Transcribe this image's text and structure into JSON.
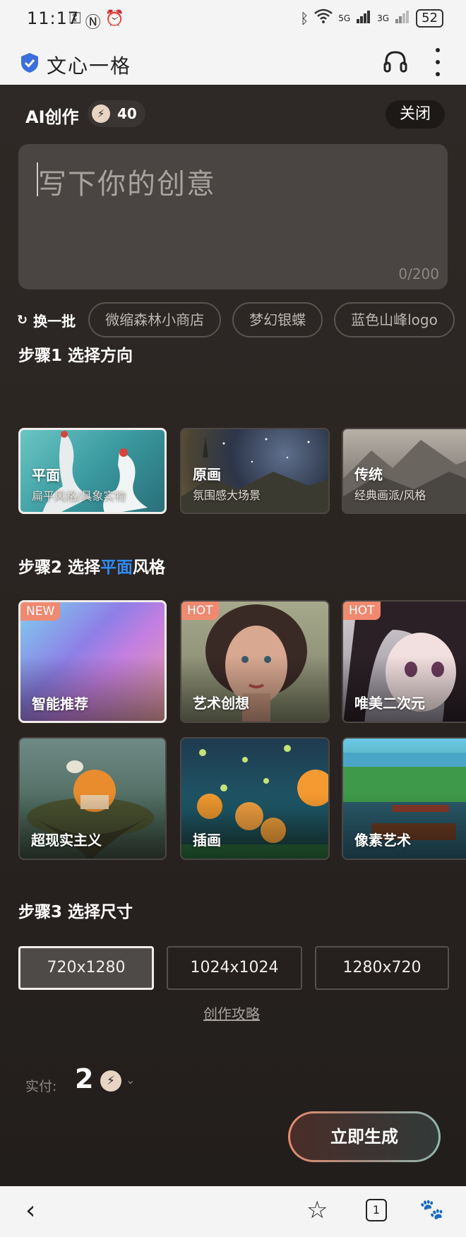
{
  "status_bar": {
    "time": "11:17",
    "left_icons": [
      "key-icon",
      "nfc-icon",
      "alarm-icon"
    ],
    "network_5g": "5G",
    "network_3g": "3G",
    "battery": "52"
  },
  "app_bar": {
    "title": "文心一格",
    "shield_color": "#3b6fe0"
  },
  "header": {
    "title": "AI创作",
    "credits": "40",
    "close_label": "关闭"
  },
  "prompt": {
    "placeholder": "写下你的创意",
    "counter": "0/200"
  },
  "suggestions": {
    "refresh_label": "换一批",
    "chips": [
      "微缩森林小商店",
      "梦幻银蝶",
      "蓝色山峰logo"
    ]
  },
  "step1": {
    "title": "步骤1 选择方向",
    "options": [
      {
        "label": "平面",
        "sub": "扁平风格/具象实物",
        "selected": true
      },
      {
        "label": "原画",
        "sub": "氛围感大场景",
        "selected": false
      },
      {
        "label": "传统",
        "sub": "经典画派/风格",
        "selected": false
      }
    ]
  },
  "step2": {
    "title_pre": "步骤2 选择",
    "title_accent": "平面",
    "title_post": "风格",
    "accent_color": "#2f8cf4",
    "styles": [
      {
        "label": "智能推荐",
        "badge": "NEW",
        "selected": true
      },
      {
        "label": "艺术创想",
        "badge": "HOT",
        "selected": false
      },
      {
        "label": "唯美二次元",
        "badge": "HOT",
        "selected": false
      },
      {
        "label": "超现实主义",
        "badge": "",
        "selected": false
      },
      {
        "label": "插画",
        "badge": "",
        "selected": false
      },
      {
        "label": "像素艺术",
        "badge": "",
        "selected": false
      }
    ]
  },
  "step3": {
    "title": "步骤3 选择尺寸",
    "sizes": [
      {
        "label": "720x1280",
        "selected": true
      },
      {
        "label": "1024x1024",
        "selected": false
      },
      {
        "label": "1280x720",
        "selected": false
      }
    ]
  },
  "guide_link": "创作攻略",
  "footer": {
    "pay_label": "实付:",
    "pay_amount": "2",
    "generate_label": "立即生成"
  },
  "bottom_nav": {
    "tab_count": "1"
  }
}
